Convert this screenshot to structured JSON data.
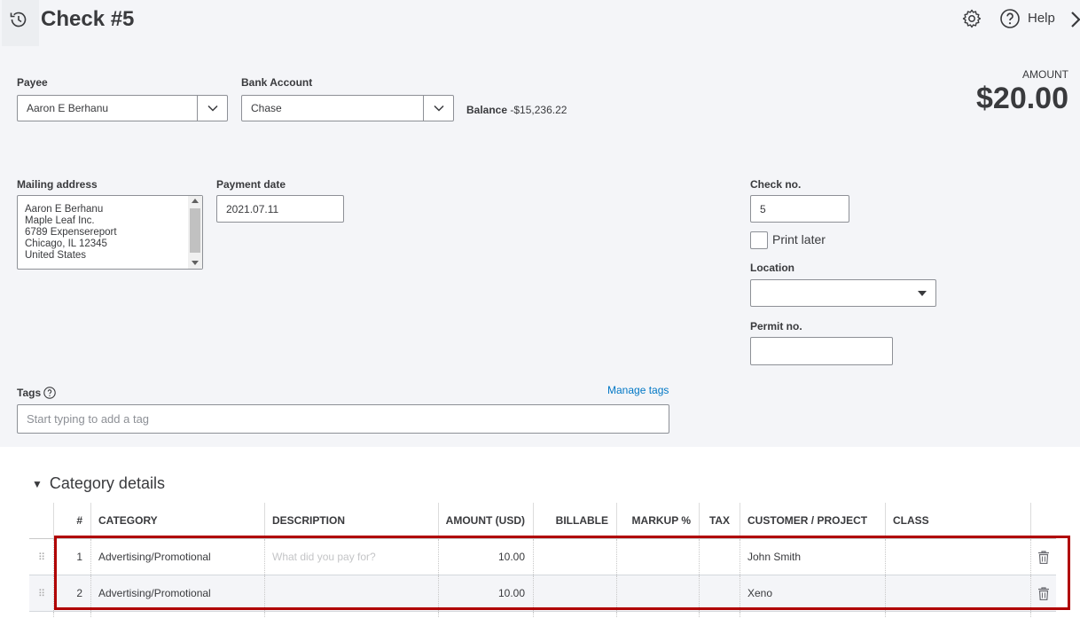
{
  "header": {
    "title": "Check #5",
    "help_label": "Help"
  },
  "payee": {
    "label": "Payee",
    "value": "Aaron E Berhanu"
  },
  "bank_account": {
    "label": "Bank Account",
    "value": "Chase",
    "balance_label": "Balance",
    "balance_value": "-$15,236.22"
  },
  "amount": {
    "label": "AMOUNT",
    "value": "$20.00"
  },
  "mailing_address": {
    "label": "Mailing address",
    "lines": [
      "Aaron E Berhanu",
      "Maple Leaf Inc.",
      "6789 Expensereport",
      "Chicago, IL  12345",
      "United States"
    ]
  },
  "payment_date": {
    "label": "Payment date",
    "value": "2021.07.11"
  },
  "check_no": {
    "label": "Check no.",
    "value": "5"
  },
  "print_later": {
    "label": "Print later",
    "checked": false
  },
  "location": {
    "label": "Location",
    "value": ""
  },
  "permit_no": {
    "label": "Permit no.",
    "value": ""
  },
  "tags": {
    "label": "Tags",
    "manage_label": "Manage tags",
    "placeholder": "Start typing to add a tag"
  },
  "category_details": {
    "section_label": "Category details",
    "columns": [
      "#",
      "CATEGORY",
      "DESCRIPTION",
      "AMOUNT (USD)",
      "BILLABLE",
      "MARKUP %",
      "TAX",
      "CUSTOMER / PROJECT",
      "CLASS"
    ],
    "rows": [
      {
        "num": "1",
        "category": "Advertising/Promotional",
        "description": "",
        "description_placeholder": "What did you pay for?",
        "amount": "10.00",
        "billable": "",
        "markup": "",
        "tax": "",
        "customer": "John Smith",
        "class": ""
      },
      {
        "num": "2",
        "category": "Advertising/Promotional",
        "description": "",
        "amount": "10.00",
        "billable": "",
        "markup": "",
        "tax": "",
        "customer": "Xeno",
        "class": ""
      }
    ]
  },
  "colors": {
    "panel_bg": "#f4f5f8",
    "link": "#0077c5",
    "highlight_border": "#b00000",
    "text": "#393a3d"
  }
}
